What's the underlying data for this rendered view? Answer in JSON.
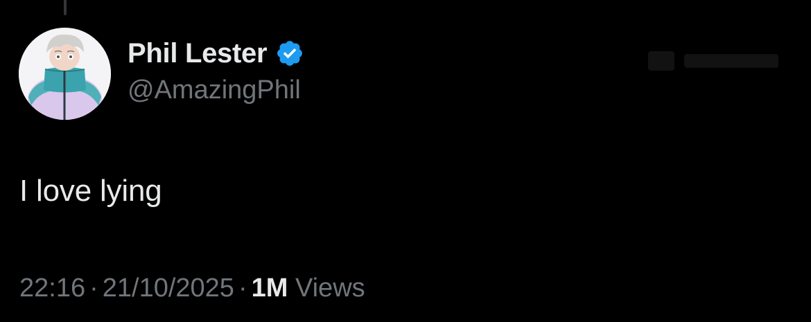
{
  "tweet": {
    "author": {
      "display_name": "Phil Lester",
      "handle": "@AmazingPhil",
      "verified": true
    },
    "text": "I love lying",
    "meta": {
      "time": "22:16",
      "date": "21/10/2025",
      "separator": "·",
      "views_count": "1M",
      "views_label": "Views"
    }
  },
  "icons": {
    "verified": "verified-badge-icon",
    "avatar": "profile-photo"
  },
  "colors": {
    "background": "#000000",
    "primary_text": "#e7e9ea",
    "secondary_text": "#71767b",
    "verified_blue": "#1d9bf0"
  }
}
